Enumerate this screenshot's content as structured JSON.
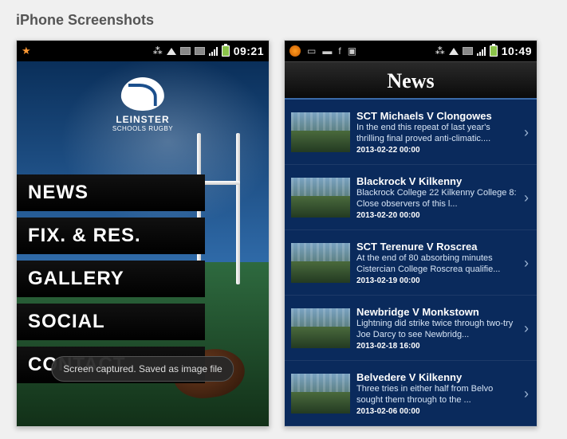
{
  "page_title": "iPhone Screenshots",
  "phone1": {
    "statusbar": {
      "time": "09:21"
    },
    "logo": {
      "line1": "LEINSTER",
      "line2": "SCHOOLS RUGBY"
    },
    "menu": [
      "NEWS",
      "FIX. & RES.",
      "GALLERY",
      "SOCIAL",
      "CONTACT"
    ],
    "toast": "Screen captured. Saved as image file"
  },
  "phone2": {
    "statusbar": {
      "time": "10:49"
    },
    "header": "News",
    "items": [
      {
        "title": "SCT Michaels V Clongowes",
        "desc": "In the end this repeat of last year's thrilling final proved anti-climatic....",
        "date": "2013-02-22 00:00"
      },
      {
        "title": "Blackrock V Kilkenny",
        "desc": "Blackrock College 22 Kilkenny College 8: Close observers of this l...",
        "date": "2013-02-20 00:00"
      },
      {
        "title": "SCT Terenure V Roscrea",
        "desc": "At the end of 80 absorbing minutes Cistercian College Roscrea qualifie...",
        "date": "2013-02-19 00:00"
      },
      {
        "title": "Newbridge V Monkstown",
        "desc": "Lightning did strike twice through two-try Joe Darcy to see Newbridg...",
        "date": "2013-02-18 16:00"
      },
      {
        "title": "Belvedere V Kilkenny",
        "desc": "Three tries in either half from Belvo sought them through to the ...",
        "date": "2013-02-06 00:00"
      }
    ]
  }
}
